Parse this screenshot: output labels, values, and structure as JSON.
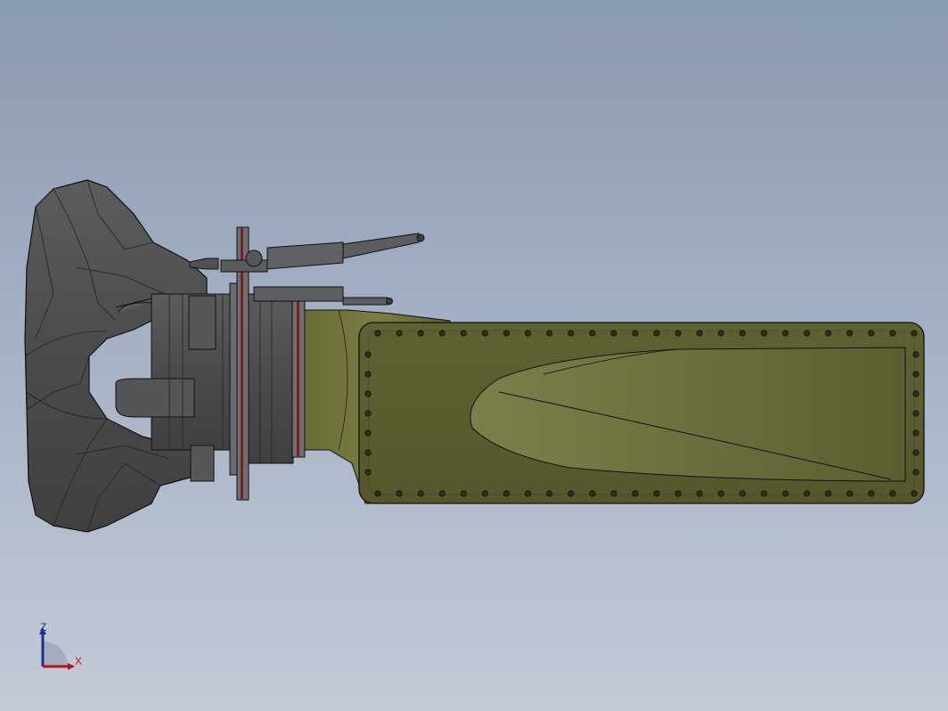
{
  "viewport": {
    "background_top": "#8a9ab0",
    "background_bottom": "#c4cad6"
  },
  "model": {
    "housing_color": "#5c5e2e",
    "housing_shade": "#6b6d3a",
    "pump_body_color": "#4d4e50",
    "flange_color": "#6e6f72",
    "gasket_color": "#7a1e1e",
    "outline_color": "#111111",
    "bolt_rows": {
      "top_count": 26,
      "bottom_count": 26,
      "left_count": 7,
      "right_count": 7
    }
  },
  "triad": {
    "z_label": "Z",
    "x_label": "X",
    "z_color": "#1f2f8f",
    "x_color": "#b01818"
  }
}
